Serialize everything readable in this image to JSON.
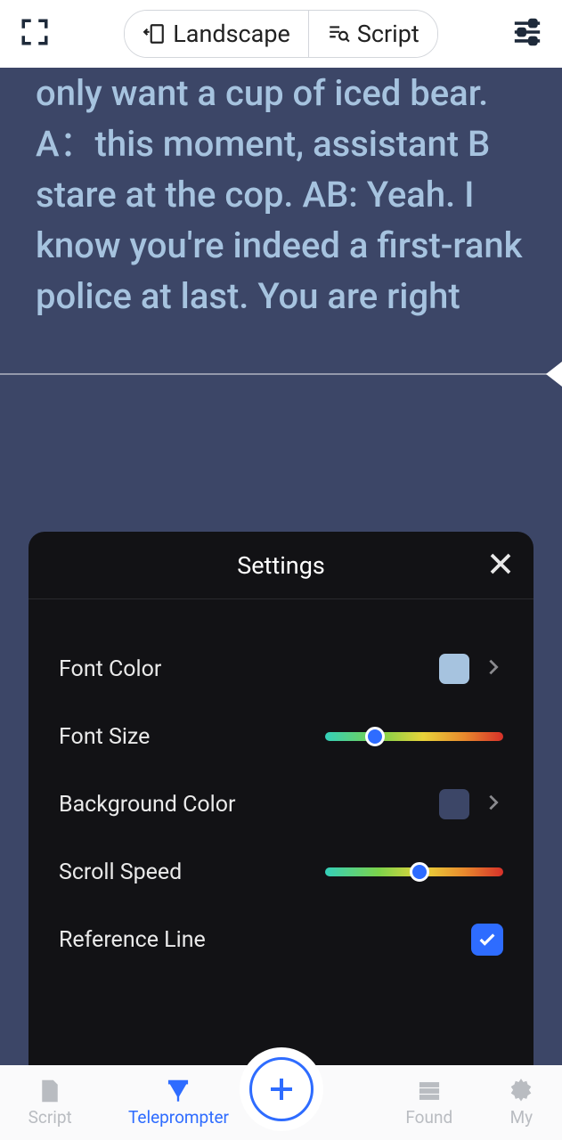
{
  "topbar": {
    "landscape_label": "Landscape",
    "script_label": "Script"
  },
  "prompter": {
    "text": "only want a cup of iced bear. A：this moment, assistant B stare at the cop. AB: Yeah. I know you're indeed a first-rank police at last. You are right"
  },
  "settings": {
    "title": "Settings",
    "rows": {
      "font_color": {
        "label": "Font Color",
        "swatch": "#a6c3df"
      },
      "font_size": {
        "label": "Font Size",
        "value_pct": 28
      },
      "background_color": {
        "label": "Background Color",
        "swatch": "#3c4667"
      },
      "scroll_speed": {
        "label": "Scroll Speed",
        "value_pct": 53
      },
      "reference_line": {
        "label": "Reference Line",
        "checked": true
      }
    }
  },
  "nav": {
    "script": "Script",
    "teleprompter": "Teleprompter",
    "found": "Found",
    "my": "My"
  }
}
